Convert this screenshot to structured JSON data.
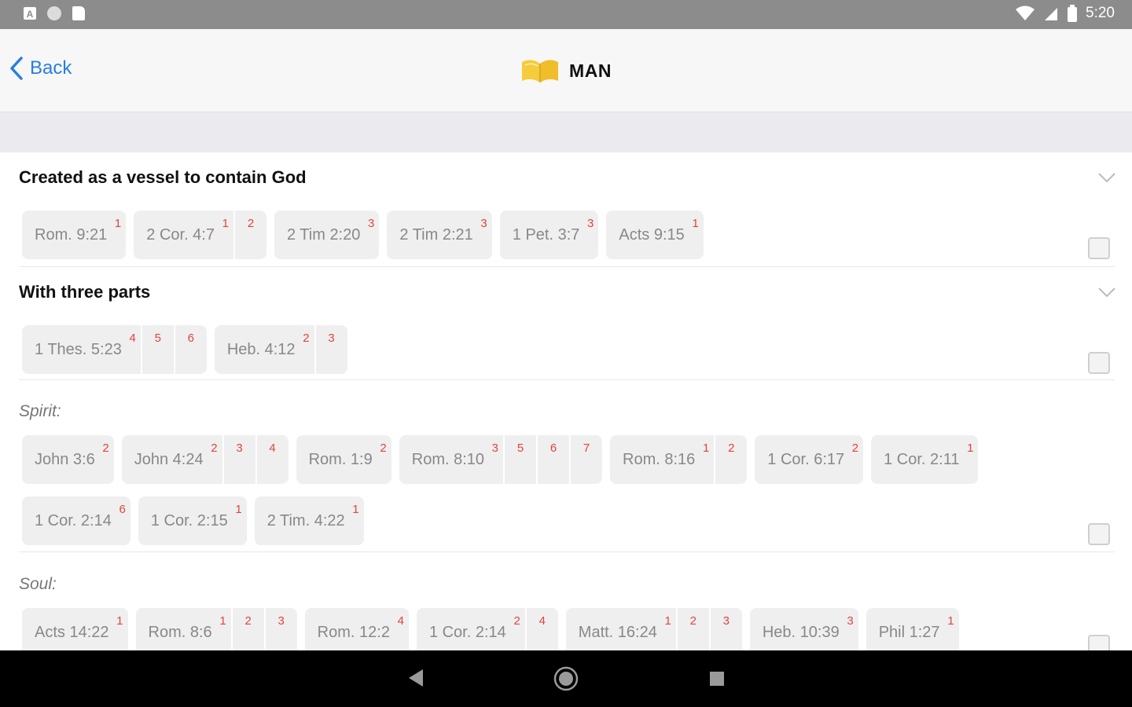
{
  "status_bar": {
    "time": "5:20"
  },
  "header": {
    "back_label": "Back",
    "title": "MAN"
  },
  "sections": [
    {
      "title": "Created as a vessel to contain God",
      "rows": [
        [
          {
            "ref": "Rom. 9:21",
            "sups": [
              "1"
            ]
          },
          {
            "ref": "2 Cor. 4:7",
            "sups": [
              "1",
              "2"
            ]
          },
          {
            "ref": "2 Tim 2:20",
            "sups": [
              "3"
            ]
          },
          {
            "ref": "2 Tim 2:21",
            "sups": [
              "3"
            ]
          },
          {
            "ref": "1 Pet. 3:7",
            "sups": [
              "3"
            ]
          },
          {
            "ref": "Acts 9:15",
            "sups": [
              "1"
            ]
          }
        ]
      ]
    },
    {
      "title": "With three parts",
      "rows": [
        [
          {
            "ref": "1 Thes. 5:23",
            "sups": [
              "4",
              "5",
              "6"
            ]
          },
          {
            "ref": "Heb. 4:12",
            "sups": [
              "2",
              "3"
            ]
          }
        ]
      ]
    },
    {
      "label": "Spirit:",
      "rows": [
        [
          {
            "ref": "John 3:6",
            "sups": [
              "2"
            ]
          },
          {
            "ref": "John 4:24",
            "sups": [
              "2",
              "3",
              "4"
            ]
          },
          {
            "ref": "Rom. 1:9",
            "sups": [
              "2"
            ]
          },
          {
            "ref": "Rom. 8:10",
            "sups": [
              "3",
              "5",
              "6",
              "7"
            ]
          },
          {
            "ref": "Rom. 8:16",
            "sups": [
              "1",
              "2"
            ]
          },
          {
            "ref": "1 Cor. 6:17",
            "sups": [
              "2"
            ]
          },
          {
            "ref": "1 Cor. 2:11",
            "sups": [
              "1"
            ]
          }
        ],
        [
          {
            "ref": "1 Cor. 2:14",
            "sups": [
              "6"
            ]
          },
          {
            "ref": "1 Cor. 2:15",
            "sups": [
              "1"
            ]
          },
          {
            "ref": "2 Tim. 4:22",
            "sups": [
              "1"
            ]
          }
        ]
      ]
    },
    {
      "label": "Soul:",
      "rows": [
        [
          {
            "ref": "Acts 14:22",
            "sups": [
              "1"
            ]
          },
          {
            "ref": "Rom. 8:6",
            "sups": [
              "1",
              "2",
              "3"
            ]
          },
          {
            "ref": "Rom. 12:2",
            "sups": [
              "4"
            ]
          },
          {
            "ref": "1 Cor. 2:14",
            "sups": [
              "2",
              "4"
            ]
          },
          {
            "ref": "Matt. 16:24",
            "sups": [
              "1",
              "2",
              "3"
            ]
          },
          {
            "ref": "Heb. 10:39",
            "sups": [
              "3"
            ]
          },
          {
            "ref": "Phil 1:27",
            "sups": [
              "1"
            ]
          }
        ]
      ]
    }
  ],
  "colors": {
    "accent": "#2a7de1",
    "superscript": "#e0453d",
    "chip_bg": "#efefef"
  }
}
